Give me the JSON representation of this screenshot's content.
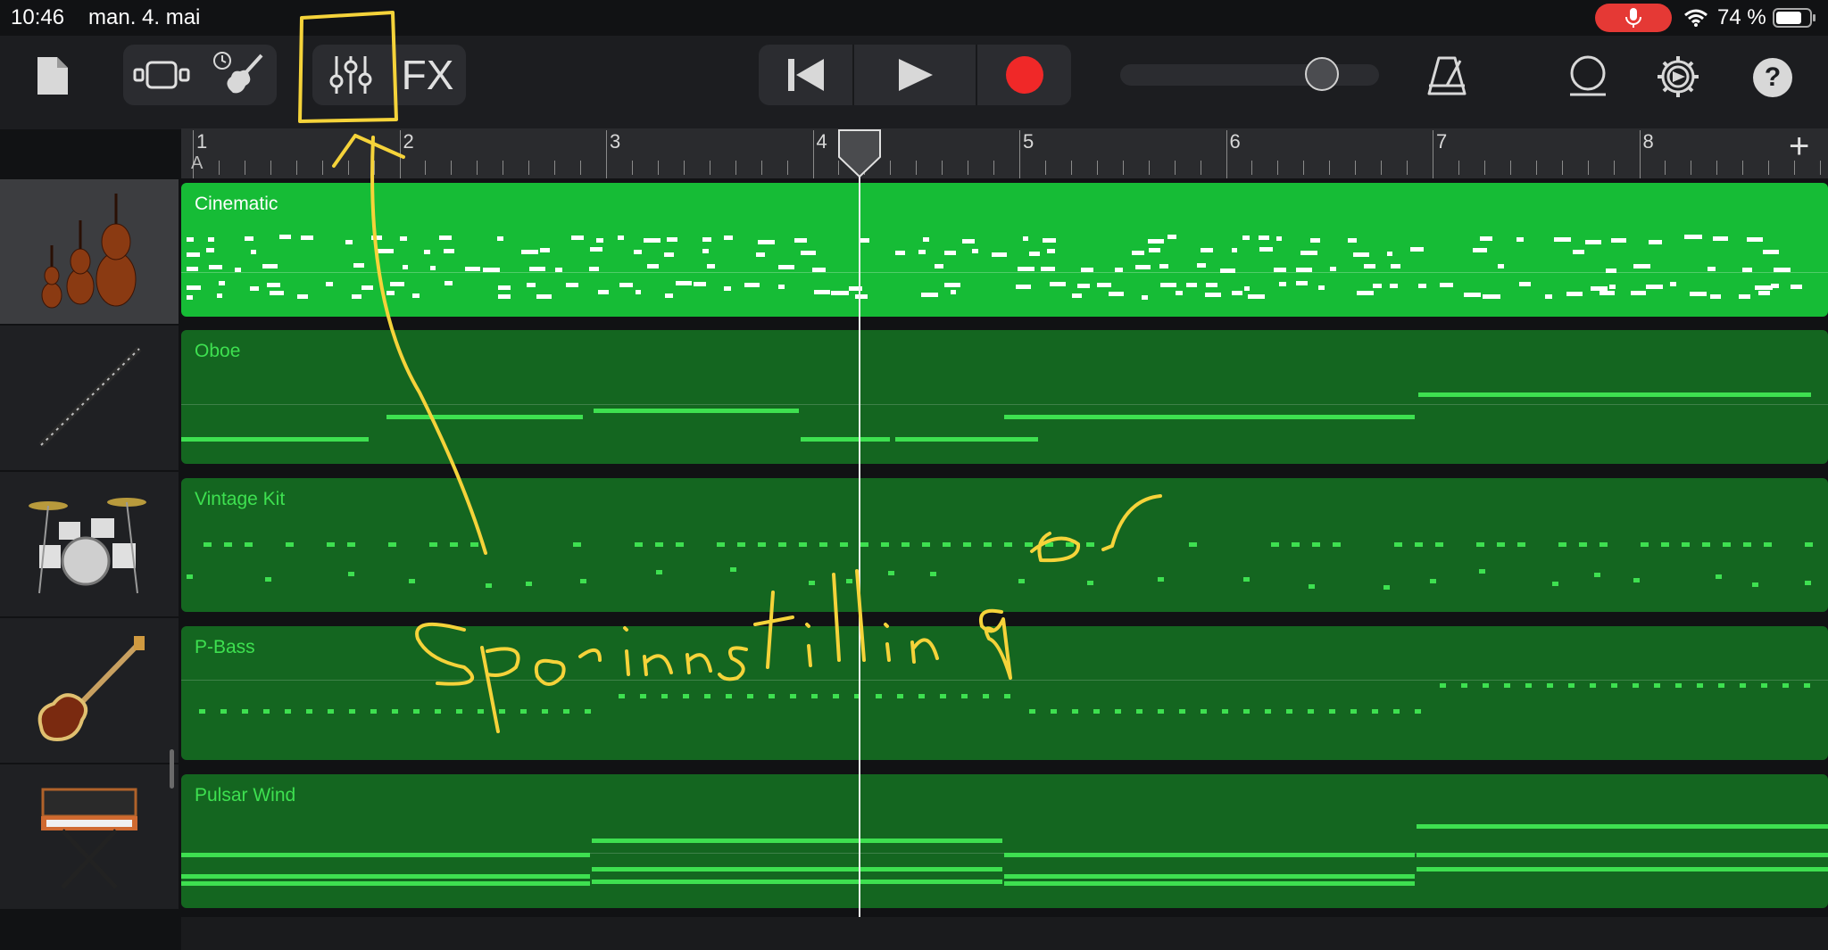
{
  "status": {
    "time": "10:46",
    "date": "man. 4. mai",
    "battery_percent": "74 %",
    "icons": [
      "microphone-icon",
      "wifi-icon",
      "battery-icon"
    ]
  },
  "toolbar": {
    "left_buttons": [
      "document-icon",
      "tracks-view-icon",
      "instrument-icon",
      "track-controls-icon"
    ],
    "fx_label": "FX",
    "transport": [
      "rewind-icon",
      "play-icon",
      "record-icon"
    ],
    "master_volume": 0.78,
    "right_buttons": [
      "metronome-icon",
      "loop-icon",
      "settings-icon",
      "help-icon"
    ],
    "help_label": "?"
  },
  "ruler": {
    "bars": [
      "1",
      "2",
      "3",
      "4",
      "5",
      "6",
      "7",
      "8"
    ],
    "section_label": "A",
    "add_label": "+"
  },
  "tracks": [
    {
      "name": "Cinematic",
      "instrument_icon": "strings-icon",
      "selected": true
    },
    {
      "name": "Oboe",
      "instrument_icon": "oboe-icon",
      "selected": false
    },
    {
      "name": "Vintage Kit",
      "instrument_icon": "drum-kit-icon",
      "selected": false
    },
    {
      "name": "P-Bass",
      "instrument_icon": "bass-guitar-icon",
      "selected": false
    },
    {
      "name": "Pulsar Wind",
      "instrument_icon": "synthesizer-icon",
      "selected": false
    }
  ],
  "colors": {
    "selected_region": "#16bc36",
    "region": "#146620",
    "note_dark": "#3ee050",
    "annotation": "#f5d33a",
    "record": "#f02828"
  },
  "annotation": {
    "handwritten_text": "Sporinnstillinger"
  }
}
